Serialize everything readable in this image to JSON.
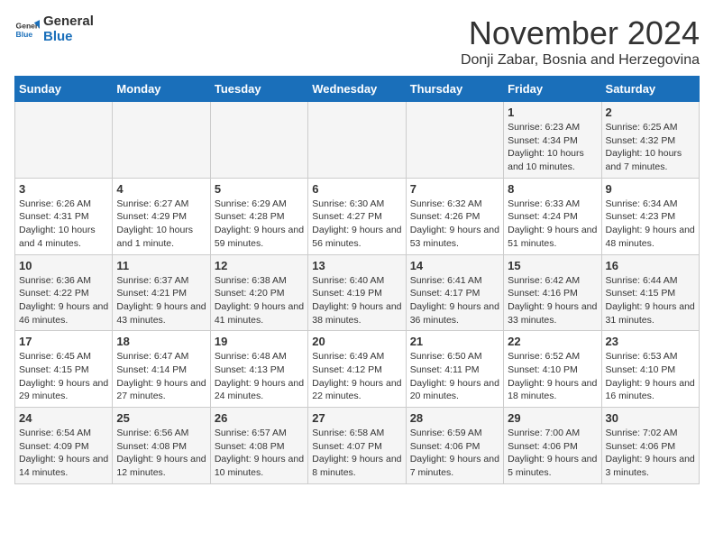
{
  "logo": {
    "general": "General",
    "blue": "Blue"
  },
  "header": {
    "month_title": "November 2024",
    "subtitle": "Donji Zabar, Bosnia and Herzegovina"
  },
  "weekdays": [
    "Sunday",
    "Monday",
    "Tuesday",
    "Wednesday",
    "Thursday",
    "Friday",
    "Saturday"
  ],
  "weeks": [
    [
      {
        "day": "",
        "info": ""
      },
      {
        "day": "",
        "info": ""
      },
      {
        "day": "",
        "info": ""
      },
      {
        "day": "",
        "info": ""
      },
      {
        "day": "",
        "info": ""
      },
      {
        "day": "1",
        "info": "Sunrise: 6:23 AM\nSunset: 4:34 PM\nDaylight: 10 hours and 10 minutes."
      },
      {
        "day": "2",
        "info": "Sunrise: 6:25 AM\nSunset: 4:32 PM\nDaylight: 10 hours and 7 minutes."
      }
    ],
    [
      {
        "day": "3",
        "info": "Sunrise: 6:26 AM\nSunset: 4:31 PM\nDaylight: 10 hours and 4 minutes."
      },
      {
        "day": "4",
        "info": "Sunrise: 6:27 AM\nSunset: 4:29 PM\nDaylight: 10 hours and 1 minute."
      },
      {
        "day": "5",
        "info": "Sunrise: 6:29 AM\nSunset: 4:28 PM\nDaylight: 9 hours and 59 minutes."
      },
      {
        "day": "6",
        "info": "Sunrise: 6:30 AM\nSunset: 4:27 PM\nDaylight: 9 hours and 56 minutes."
      },
      {
        "day": "7",
        "info": "Sunrise: 6:32 AM\nSunset: 4:26 PM\nDaylight: 9 hours and 53 minutes."
      },
      {
        "day": "8",
        "info": "Sunrise: 6:33 AM\nSunset: 4:24 PM\nDaylight: 9 hours and 51 minutes."
      },
      {
        "day": "9",
        "info": "Sunrise: 6:34 AM\nSunset: 4:23 PM\nDaylight: 9 hours and 48 minutes."
      }
    ],
    [
      {
        "day": "10",
        "info": "Sunrise: 6:36 AM\nSunset: 4:22 PM\nDaylight: 9 hours and 46 minutes."
      },
      {
        "day": "11",
        "info": "Sunrise: 6:37 AM\nSunset: 4:21 PM\nDaylight: 9 hours and 43 minutes."
      },
      {
        "day": "12",
        "info": "Sunrise: 6:38 AM\nSunset: 4:20 PM\nDaylight: 9 hours and 41 minutes."
      },
      {
        "day": "13",
        "info": "Sunrise: 6:40 AM\nSunset: 4:19 PM\nDaylight: 9 hours and 38 minutes."
      },
      {
        "day": "14",
        "info": "Sunrise: 6:41 AM\nSunset: 4:17 PM\nDaylight: 9 hours and 36 minutes."
      },
      {
        "day": "15",
        "info": "Sunrise: 6:42 AM\nSunset: 4:16 PM\nDaylight: 9 hours and 33 minutes."
      },
      {
        "day": "16",
        "info": "Sunrise: 6:44 AM\nSunset: 4:15 PM\nDaylight: 9 hours and 31 minutes."
      }
    ],
    [
      {
        "day": "17",
        "info": "Sunrise: 6:45 AM\nSunset: 4:15 PM\nDaylight: 9 hours and 29 minutes."
      },
      {
        "day": "18",
        "info": "Sunrise: 6:47 AM\nSunset: 4:14 PM\nDaylight: 9 hours and 27 minutes."
      },
      {
        "day": "19",
        "info": "Sunrise: 6:48 AM\nSunset: 4:13 PM\nDaylight: 9 hours and 24 minutes."
      },
      {
        "day": "20",
        "info": "Sunrise: 6:49 AM\nSunset: 4:12 PM\nDaylight: 9 hours and 22 minutes."
      },
      {
        "day": "21",
        "info": "Sunrise: 6:50 AM\nSunset: 4:11 PM\nDaylight: 9 hours and 20 minutes."
      },
      {
        "day": "22",
        "info": "Sunrise: 6:52 AM\nSunset: 4:10 PM\nDaylight: 9 hours and 18 minutes."
      },
      {
        "day": "23",
        "info": "Sunrise: 6:53 AM\nSunset: 4:10 PM\nDaylight: 9 hours and 16 minutes."
      }
    ],
    [
      {
        "day": "24",
        "info": "Sunrise: 6:54 AM\nSunset: 4:09 PM\nDaylight: 9 hours and 14 minutes."
      },
      {
        "day": "25",
        "info": "Sunrise: 6:56 AM\nSunset: 4:08 PM\nDaylight: 9 hours and 12 minutes."
      },
      {
        "day": "26",
        "info": "Sunrise: 6:57 AM\nSunset: 4:08 PM\nDaylight: 9 hours and 10 minutes."
      },
      {
        "day": "27",
        "info": "Sunrise: 6:58 AM\nSunset: 4:07 PM\nDaylight: 9 hours and 8 minutes."
      },
      {
        "day": "28",
        "info": "Sunrise: 6:59 AM\nSunset: 4:06 PM\nDaylight: 9 hours and 7 minutes."
      },
      {
        "day": "29",
        "info": "Sunrise: 7:00 AM\nSunset: 4:06 PM\nDaylight: 9 hours and 5 minutes."
      },
      {
        "day": "30",
        "info": "Sunrise: 7:02 AM\nSunset: 4:06 PM\nDaylight: 9 hours and 3 minutes."
      }
    ]
  ]
}
